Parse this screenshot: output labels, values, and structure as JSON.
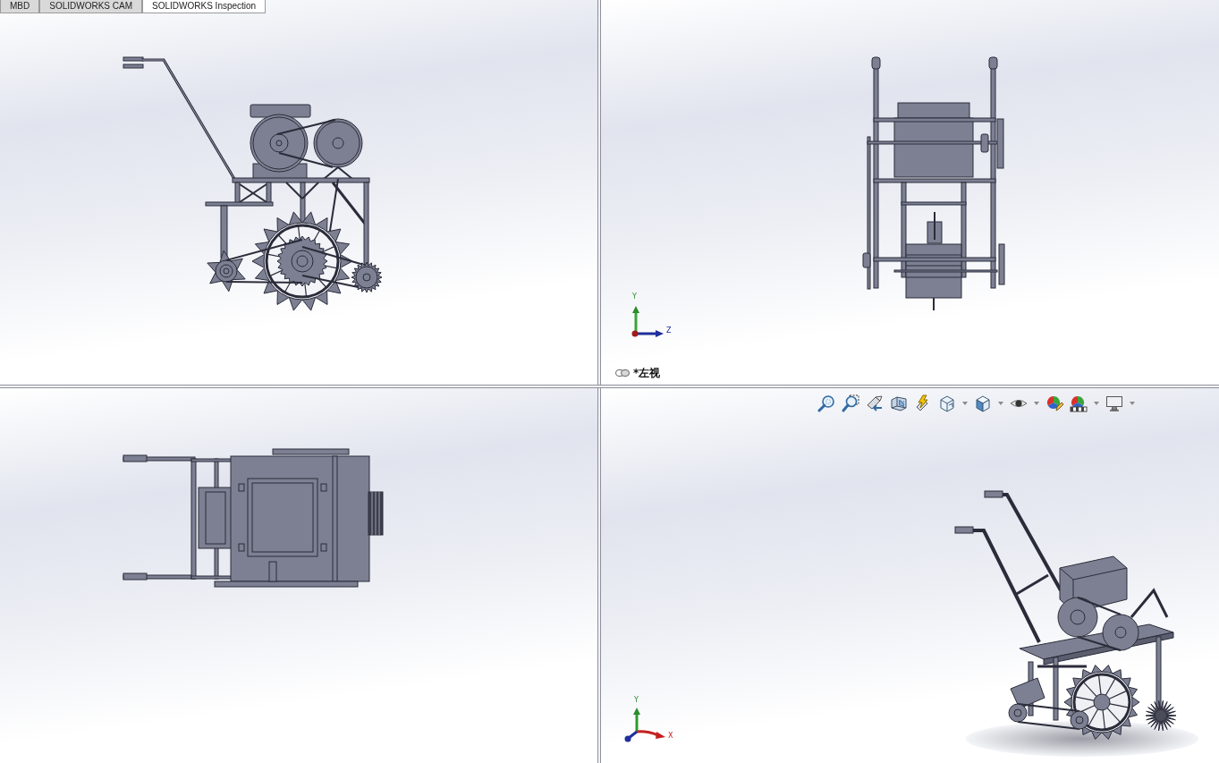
{
  "command_tabs": [
    {
      "label": "MBD",
      "selected": false
    },
    {
      "label": "SOLIDWORKS CAM",
      "selected": false
    },
    {
      "label": "SOLIDWORKS Inspection",
      "selected": true
    }
  ],
  "viewports": [
    {
      "kind": "side"
    },
    {
      "kind": "left",
      "view_label": "*左视",
      "triad": {
        "kind": "planar",
        "axes": [
          "Y",
          "Z"
        ]
      }
    },
    {
      "kind": "top"
    },
    {
      "kind": "iso",
      "triad": {
        "kind": "iso",
        "axes": [
          "Y",
          "X"
        ]
      },
      "toolbar": [
        {
          "kind": "magnifier",
          "dropdown": false
        },
        {
          "kind": "magnifier-frame",
          "dropdown": false
        },
        {
          "kind": "pencil-arrow",
          "dropdown": false
        },
        {
          "kind": "section-cube",
          "dropdown": false
        },
        {
          "kind": "lightning-bolt",
          "dropdown": false
        },
        {
          "kind": "cube",
          "dropdown": true
        },
        {
          "kind": "shaded-cube",
          "dropdown": true
        },
        {
          "kind": "eye",
          "dropdown": true
        },
        {
          "kind": "color-ball-pencil",
          "dropdown": false
        },
        {
          "kind": "color-ball",
          "dropdown": true
        },
        {
          "kind": "monitor",
          "dropdown": true
        }
      ]
    }
  ]
}
